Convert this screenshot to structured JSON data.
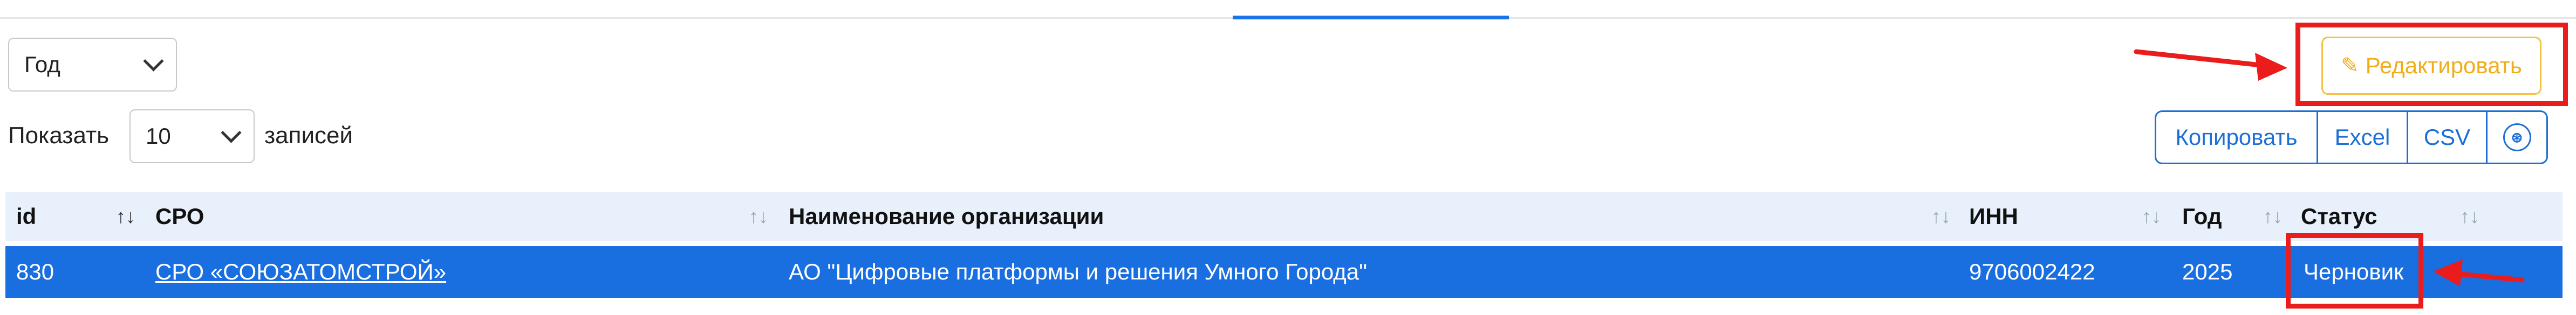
{
  "year_filter": {
    "value": "Год"
  },
  "page_length": {
    "prefix": "Показать",
    "value": "10",
    "suffix": "записей"
  },
  "toolbar": {
    "edit_label": "Редактировать"
  },
  "export_buttons": {
    "copy": "Копировать",
    "excel": "Excel",
    "csv": "CSV"
  },
  "table": {
    "headers": {
      "id": "id",
      "sro": "СРО",
      "org": "Наименование организации",
      "inn": "ИНН",
      "year": "Год",
      "status": "Статус"
    },
    "rows": [
      {
        "id": "830",
        "sro": "СРО «СОЮЗАТОМСТРОЙ»",
        "org": "АО \"Цифровые платформы и решения Умного Города\"",
        "inn": "9706002422",
        "year": "2025",
        "status": "Черновик"
      }
    ]
  },
  "colors": {
    "accent": "#1a6fe0",
    "edit": "#f0ad1a",
    "annotation": "#ea1c1c"
  }
}
